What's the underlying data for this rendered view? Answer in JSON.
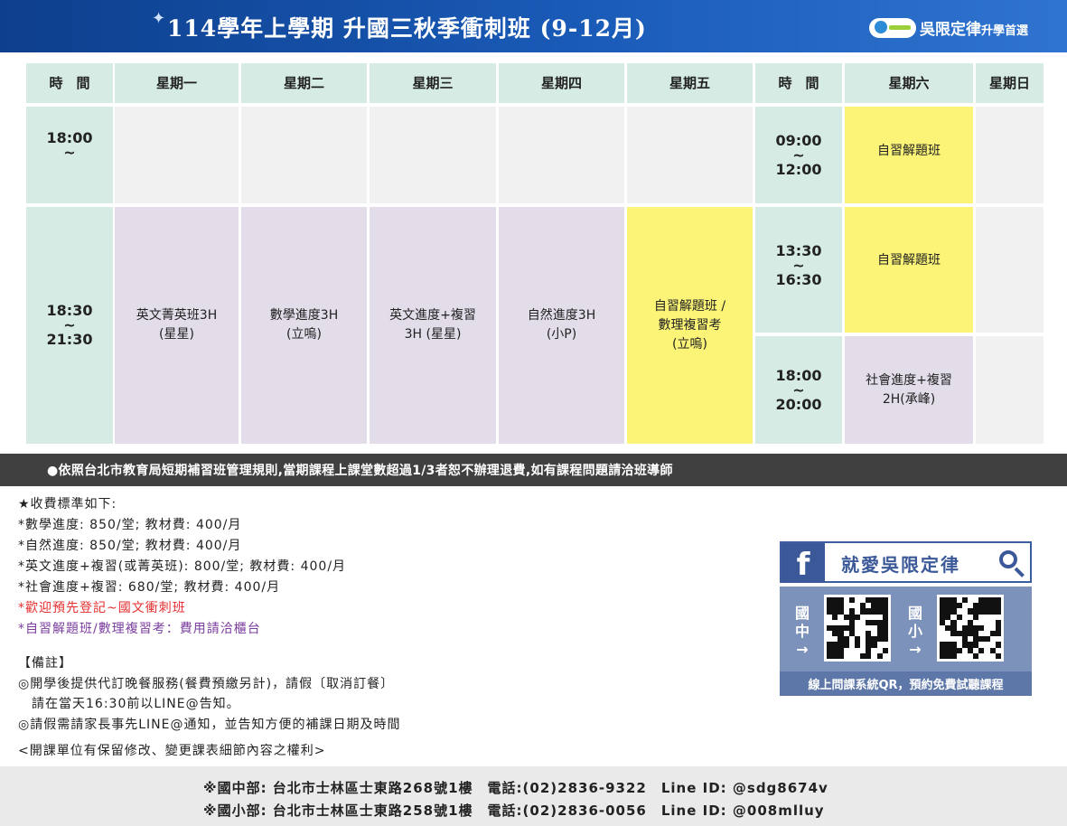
{
  "header": {
    "title": "114學年上學期  升國三秋季衝刺班 (9-12月)",
    "brand_main": "吳限定律",
    "brand_sub": "升學首選"
  },
  "timetable": {
    "headers": [
      "時　間",
      "星期一",
      "星期二",
      "星期三",
      "星期四",
      "星期五",
      "時　間",
      "星期六",
      "星期日"
    ],
    "weekday_times": {
      "row1": {
        "start": "18:00",
        "sep": "~"
      },
      "row2": {
        "start": "18:30",
        "sep": "~",
        "end": "21:30"
      }
    },
    "weekday_classes": {
      "mon": {
        "line1": "英文菁英班3H",
        "line2": "(星星)"
      },
      "tue": {
        "line1": "數學進度3H",
        "line2": "(立嗚)"
      },
      "wed": {
        "line1": "英文進度+複習",
        "line2": "3H (星星)"
      },
      "thu": {
        "line1": "自然進度3H",
        "line2": "(小P)"
      },
      "fri": {
        "line1": "自習解題班 /",
        "line2": "數理複習考",
        "line3": "(立嗚)"
      }
    },
    "weekend_times": [
      {
        "start": "09:00",
        "sep": "~",
        "end": "12:00"
      },
      {
        "start": "13:30",
        "sep": "~",
        "end": "16:30"
      },
      {
        "start": "18:00",
        "sep": "~",
        "end": "20:00"
      }
    ],
    "saturday_classes": [
      {
        "line1": "自習解題班"
      },
      {
        "line1": "自習解題班"
      },
      {
        "line1": "社會進度+複習",
        "line2": "2H(承峰)"
      }
    ],
    "colors": {
      "header": "#d6ebe4",
      "empty": "#f1f1f1",
      "lecture": "#e3dce9",
      "self_study": "#fbf477"
    }
  },
  "notice": "●依照台北市教育局短期補習班管理規則,當期課程上課堂數超過1/3者恕不辦理退費,如有課程問題請洽班導師",
  "fees": {
    "title": "★收費標準如下:",
    "items": [
      "*數學進度: 850/堂; 教材費: 400/月",
      "*自然進度: 850/堂; 教材費: 400/月",
      "*英文進度+複習(或菁英班): 800/堂; 教材費: 400/月",
      "*社會進度+複習: 680/堂; 教材費: 400/月"
    ],
    "red_line": "*歡迎預先登記~國文衝刺班",
    "purple_line": "*自習解題班/數理複習考：費用請洽櫃台"
  },
  "notes": {
    "title": "【備註】",
    "line1": "◎開學後提供代訂晚餐服務(餐費預繳另計)，請假〔取消訂餐〕",
    "line2": "　請在當天16:30前以LINE@告知。",
    "line3": "◎請假需請家長事先LINE@通知，並告知方便的補課日期及時間"
  },
  "rights": "<開課單位有保留修改、變更課表細節內容之權利>",
  "facebook": {
    "logo": "f",
    "search_text": "就愛吳限定律",
    "qr_left_label": [
      "國",
      "中",
      "→"
    ],
    "qr_right_label": [
      "國",
      "小",
      "→"
    ],
    "caption": "線上問課系統QR，預約免費試聽課程"
  },
  "footer": {
    "line1": "※國中部: 台北市士林區士東路268號1樓　電話:(02)2836-9322　Line ID: @sdg8674v",
    "line2": "※國小部: 台北市士林區士東路258號1樓　電話:(02)2836-0056　Line ID: @008mlluy"
  }
}
